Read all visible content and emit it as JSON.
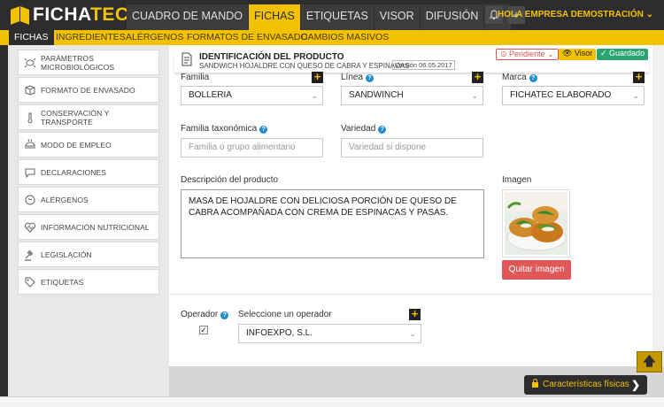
{
  "app": {
    "logo_part1": "FICHA",
    "logo_part2": "TEC"
  },
  "topnav": {
    "items": [
      {
        "label": "CUADRO DE MANDO"
      },
      {
        "label": "FICHAS"
      },
      {
        "label": "ETIQUETAS"
      },
      {
        "label": "VISOR"
      },
      {
        "label": "DIFUSIÓN"
      }
    ],
    "gear_icon": "⚙",
    "bell_icon": "bell-icon",
    "plus_icon": "+",
    "user": "HOLA EMPRESA DEMOSTRACIÓN ⌄"
  },
  "subnav": {
    "items": [
      {
        "label": "FICHAS"
      },
      {
        "label": "INGREDIENTES"
      },
      {
        "label": "ALÉRGENOS"
      },
      {
        "label": "FORMATOS DE ENVASADO"
      },
      {
        "label": "CAMBIOS MASIVOS"
      }
    ]
  },
  "sidebar": {
    "items": [
      {
        "label": "PARÁMETROS MICROBIOLÓGICOS"
      },
      {
        "label": "FORMATO DE ENVASADO"
      },
      {
        "label": "CONSERVACIÓN Y TRANSPORTE"
      },
      {
        "label": "MODO DE EMPLEO"
      },
      {
        "label": "DECLARACIONES"
      },
      {
        "label": "ALÉRGENOS"
      },
      {
        "label": "INFORMACIÓN NUTRICIONAL"
      },
      {
        "label": "LEGISLACIÓN"
      },
      {
        "label": "ETIQUETAS"
      }
    ]
  },
  "product": {
    "section_title": "IDENTIFICACIÓN DEL PRODUCTO",
    "name": "SANDWICH HOJALDRE CON QUESO DE CABRA Y ESPINACAS",
    "version": "Versión 06.05.2017",
    "status_pending": "⊙ Pendiente ⌄",
    "status_visor": "👁 Visor",
    "status_saved": "✓ Guardado"
  },
  "form": {
    "familia": {
      "label": "Familia",
      "value": "BOLLERIA"
    },
    "linea": {
      "label": "Línea",
      "value": "SANDWINCH"
    },
    "marca": {
      "label": "Marca",
      "value": "FICHATEC ELABORADO"
    },
    "familia_taxonomica": {
      "label": "Familia taxonómica",
      "placeholder": "Familia o grupo alimentario"
    },
    "variedad": {
      "label": "Variedad",
      "placeholder": "Variedad si dispone"
    },
    "descripcion": {
      "label": "Descripción del producto",
      "value": "MASA DE HOJALDRE CON DELICIOSA PORCIÓN DE QUESO DE CABRA ACOMPAÑADA CON CREMA DE ESPINACAS Y PASAS."
    },
    "imagen": {
      "label": "Imagen",
      "remove_label": "Quitar imagen"
    },
    "operador": {
      "label": "Operador",
      "checked": "✓"
    },
    "seleccione_operador": {
      "label": "Seleccione un operador",
      "value": "INFOEXPO, S.L."
    }
  },
  "actions": {
    "scroll_top": "🡅",
    "features_label": "Características físicas",
    "features_arrow": "❯"
  },
  "colors": {
    "brand_yellow": "#f2c200",
    "dark": "#2d2d2d",
    "danger": "#df5757",
    "success": "#2aa572",
    "info": "#1f8bd0"
  }
}
